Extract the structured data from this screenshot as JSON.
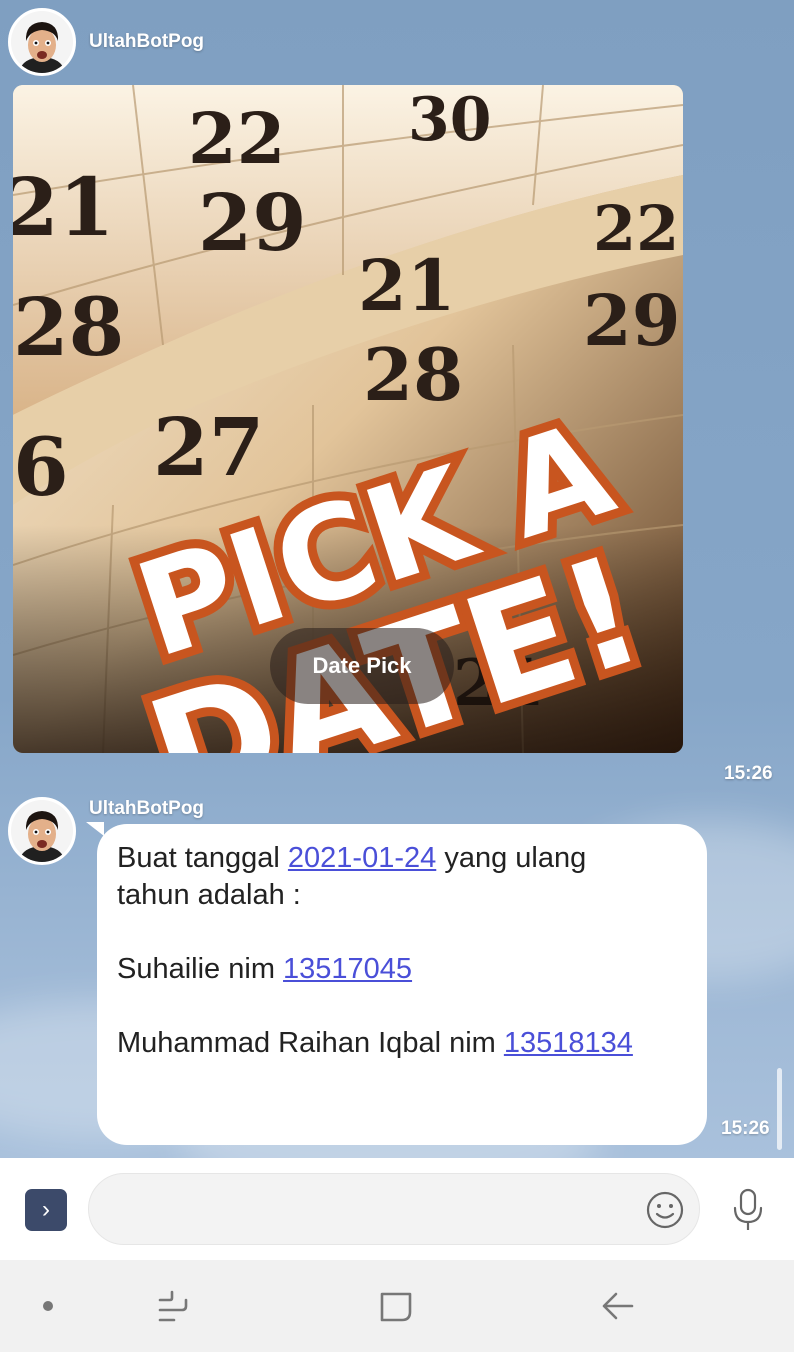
{
  "messages": [
    {
      "sender": "UltahBotPog",
      "type": "image",
      "image_text": "PICK A DATE!",
      "button_label": "Date Pick",
      "time": "15:26"
    },
    {
      "sender": "UltahBotPog",
      "type": "text",
      "line1_prefix": "Buat tanggal ",
      "date_link": "2021-01-24",
      "line1_suffix": " yang ulang",
      "line2": "tahun adalah :",
      "person1": "Suhailie nim ",
      "nim1": "13517045",
      "person2": "Muhammad Raihan Iqbal nim ",
      "nim2": "13518134",
      "time": "15:26"
    }
  ],
  "colors": {
    "chat_background": "#7f9fc1",
    "link": "#4a4fd8",
    "expand_button": "#3c4a6a"
  },
  "icons": {
    "expand": "chevron-right-icon",
    "emoji": "smiley-icon",
    "mic": "microphone-icon",
    "nav": [
      "dot-icon",
      "recent-apps-icon",
      "home-icon",
      "back-icon"
    ]
  }
}
